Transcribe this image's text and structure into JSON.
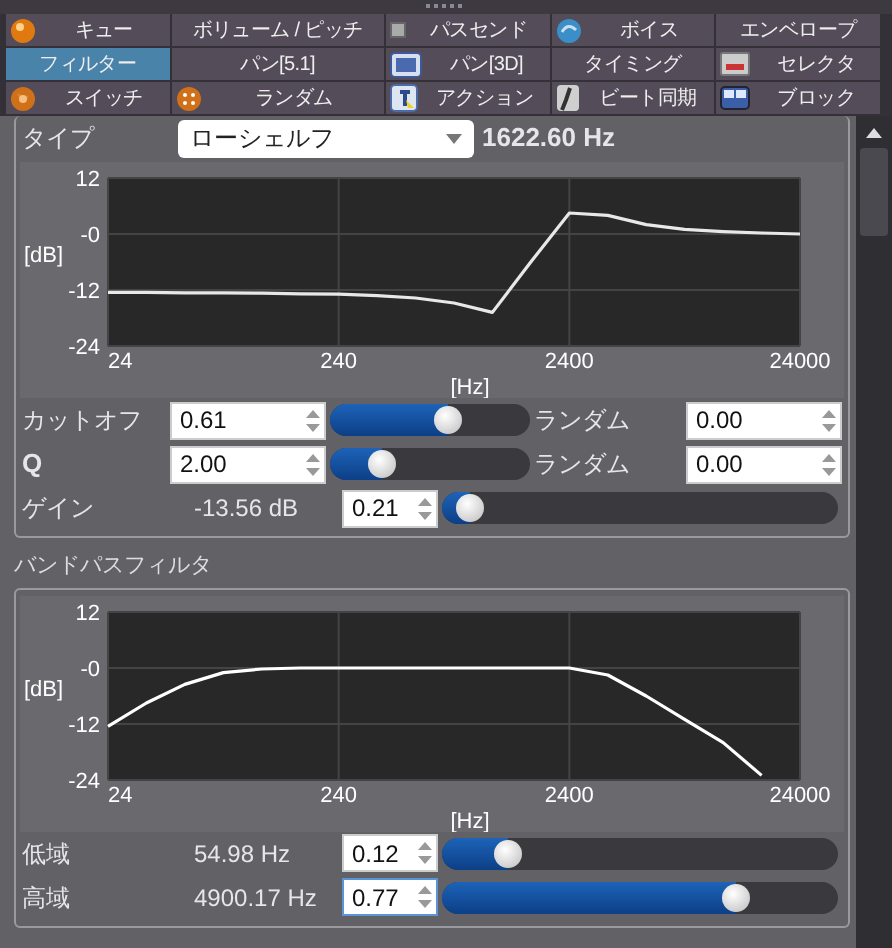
{
  "tabs": [
    {
      "label": "キュー",
      "selected": false
    },
    {
      "label": "ボリューム / ピッチ",
      "selected": false
    },
    {
      "label": "パスセンド",
      "selected": false
    },
    {
      "label": "ボイス",
      "selected": false
    },
    {
      "label": "エンベロープ",
      "selected": false
    },
    {
      "label": "フィルター",
      "selected": true
    },
    {
      "label": "パン[5.1]",
      "selected": false
    },
    {
      "label": "パン[3D]",
      "selected": false
    },
    {
      "label": "タイミング",
      "selected": false
    },
    {
      "label": "セレクタ",
      "selected": false
    },
    {
      "label": "スイッチ",
      "selected": false
    },
    {
      "label": "ランダム",
      "selected": false
    },
    {
      "label": "アクション",
      "selected": false
    },
    {
      "label": "ビート同期",
      "selected": false
    },
    {
      "label": "ブロック",
      "selected": false
    }
  ],
  "filter": {
    "type_label": "タイプ",
    "type_value": "ローシェルフ",
    "frequency": "1622.60 Hz",
    "chart_data": {
      "type": "line",
      "grid": true,
      "xlabel": "[Hz]",
      "ylabel": "[dB]",
      "ylim": [
        -24,
        12
      ],
      "yticks": [
        -24,
        -12,
        {
          "value": 0,
          "label": "-0"
        },
        12
      ],
      "categories": [
        "24",
        null,
        null,
        null,
        null,
        null,
        "240",
        null,
        null,
        null,
        null,
        null,
        "2400",
        null,
        null,
        null,
        null,
        null,
        "24000"
      ],
      "series": [
        {
          "color": "#e8e8e8",
          "values": [
            -12.5,
            -12.5,
            -12.6,
            -12.6,
            -12.7,
            -12.8,
            -12.9,
            -13.2,
            -13.7,
            -14.8,
            -16.8,
            -6,
            4.5,
            4,
            2,
            1,
            0.5,
            0.2,
            0
          ]
        }
      ]
    },
    "controls": [
      {
        "kind": "spin-slider-random",
        "label": "カットオフ",
        "bold": false,
        "value": "0.61",
        "level": 0.6,
        "focused": false,
        "random_label": "ランダム",
        "random_value": "0.00"
      },
      {
        "kind": "spin-slider-random",
        "label": "Q",
        "bold": true,
        "value": "2.00",
        "level": 0.22,
        "focused": false,
        "random_label": "ランダム",
        "random_value": "0.00"
      },
      {
        "kind": "readout-spin-slider",
        "label": "ゲイン",
        "bold": false,
        "reading": "-13.56 dB",
        "value": "0.21",
        "level": 0.04,
        "focused": false
      }
    ]
  },
  "bandpass": {
    "title": "バンドパスフィルタ",
    "chart_data": {
      "type": "line",
      "grid": true,
      "xlabel": "[Hz]",
      "ylabel": "[dB]",
      "ylim": [
        -24,
        12
      ],
      "yticks": [
        -24,
        -12,
        {
          "value": 0,
          "label": "-0"
        },
        12
      ],
      "categories": [
        "24",
        null,
        null,
        null,
        null,
        null,
        "240",
        null,
        null,
        null,
        null,
        null,
        "2400",
        null,
        null,
        null,
        null,
        null,
        "24000"
      ],
      "series": [
        {
          "color": "#ffffff",
          "values": [
            -12.5,
            -7.5,
            -3.5,
            -1,
            -0.2,
            0,
            0,
            0,
            0,
            0,
            0,
            0,
            0,
            -1.5,
            -6,
            -11,
            -16,
            -23,
            null
          ]
        }
      ]
    },
    "controls": [
      {
        "kind": "readout-spin-slider",
        "label": "低域",
        "bold": false,
        "reading": "54.98 Hz",
        "value": "0.12",
        "level": 0.14,
        "focused": false
      },
      {
        "kind": "readout-spin-slider",
        "label": "高域",
        "bold": false,
        "reading": "4900.17 Hz",
        "value": "0.77",
        "level": 0.76,
        "focused": true
      }
    ]
  }
}
